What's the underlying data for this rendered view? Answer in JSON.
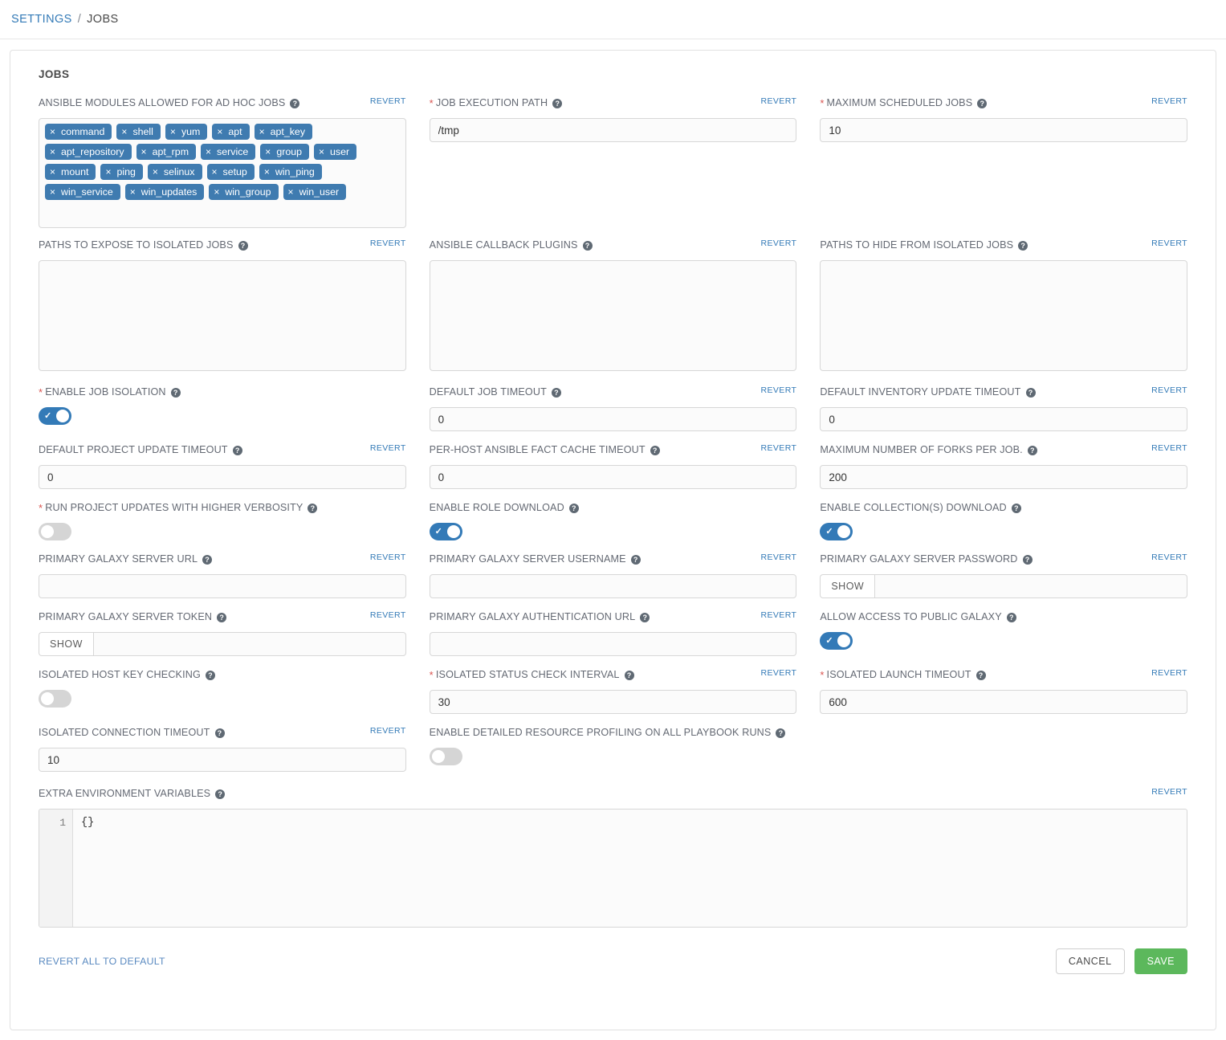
{
  "breadcrumb": {
    "root": "SETTINGS",
    "separator": "/",
    "current": "JOBS"
  },
  "panel": {
    "title": "JOBS",
    "revert_label": "REVERT",
    "show_label": "SHOW",
    "help_glyph": "?",
    "required_glyph": "*"
  },
  "colors": {
    "accent_blue": "#337ab7",
    "chip_blue": "#3f7bb0",
    "save_green": "#5cb85c",
    "required_red": "#d9534f",
    "label_gray": "#646973"
  },
  "fields": {
    "ansible_modules": {
      "label": "ANSIBLE MODULES ALLOWED FOR AD HOC JOBS",
      "required": false,
      "chips": [
        "command",
        "shell",
        "yum",
        "apt",
        "apt_key",
        "apt_repository",
        "apt_rpm",
        "service",
        "group",
        "user",
        "mount",
        "ping",
        "selinux",
        "setup",
        "win_ping",
        "win_service",
        "win_updates",
        "win_group",
        "win_user"
      ]
    },
    "job_execution_path": {
      "label": "JOB EXECUTION PATH",
      "required": true,
      "value": "/tmp"
    },
    "maximum_scheduled_jobs": {
      "label": "MAXIMUM SCHEDULED JOBS",
      "required": true,
      "value": "10"
    },
    "paths_expose_isolated": {
      "label": "PATHS TO EXPOSE TO ISOLATED JOBS",
      "required": false,
      "value": ""
    },
    "ansible_callback_plugins": {
      "label": "ANSIBLE CALLBACK PLUGINS",
      "required": false,
      "value": ""
    },
    "paths_hide_isolated": {
      "label": "PATHS TO HIDE FROM ISOLATED JOBS",
      "required": false,
      "value": ""
    },
    "enable_job_isolation": {
      "label": "ENABLE JOB ISOLATION",
      "required": true,
      "value": "on"
    },
    "default_job_timeout": {
      "label": "DEFAULT JOB TIMEOUT",
      "required": false,
      "value": "0"
    },
    "default_inventory_update_timeout": {
      "label": "DEFAULT INVENTORY UPDATE TIMEOUT",
      "required": false,
      "value": "0"
    },
    "default_project_update_timeout": {
      "label": "DEFAULT PROJECT UPDATE TIMEOUT",
      "required": false,
      "value": "0"
    },
    "per_host_fact_cache_timeout": {
      "label": "PER-HOST ANSIBLE FACT CACHE TIMEOUT",
      "required": false,
      "value": "0"
    },
    "maximum_forks_per_job": {
      "label": "MAXIMUM NUMBER OF FORKS PER JOB.",
      "required": false,
      "value": "200"
    },
    "project_updates_verbosity": {
      "label": "RUN PROJECT UPDATES WITH HIGHER VERBOSITY",
      "required": true,
      "value": "off"
    },
    "enable_role_download": {
      "label": "ENABLE ROLE DOWNLOAD",
      "required": false,
      "value": "on"
    },
    "enable_collections_download": {
      "label": "ENABLE COLLECTION(S) DOWNLOAD",
      "required": false,
      "value": "on"
    },
    "galaxy_server_url": {
      "label": "PRIMARY GALAXY SERVER URL",
      "required": false,
      "value": ""
    },
    "galaxy_server_username": {
      "label": "PRIMARY GALAXY SERVER USERNAME",
      "required": false,
      "value": ""
    },
    "galaxy_server_password": {
      "label": "PRIMARY GALAXY SERVER PASSWORD",
      "required": false,
      "value": ""
    },
    "galaxy_server_token": {
      "label": "PRIMARY GALAXY SERVER TOKEN",
      "required": false,
      "value": ""
    },
    "galaxy_auth_url": {
      "label": "PRIMARY GALAXY AUTHENTICATION URL",
      "required": false,
      "value": ""
    },
    "allow_public_galaxy": {
      "label": "ALLOW ACCESS TO PUBLIC GALAXY",
      "required": false,
      "value": "on"
    },
    "isolated_host_key_checking": {
      "label": "ISOLATED HOST KEY CHECKING",
      "required": false,
      "value": "off"
    },
    "isolated_status_check_interval": {
      "label": "ISOLATED STATUS CHECK INTERVAL",
      "required": true,
      "value": "30"
    },
    "isolated_launch_timeout": {
      "label": "ISOLATED LAUNCH TIMEOUT",
      "required": true,
      "value": "600"
    },
    "isolated_connection_timeout": {
      "label": "ISOLATED CONNECTION TIMEOUT",
      "required": false,
      "value": "10"
    },
    "detailed_resource_profiling": {
      "label": "ENABLE DETAILED RESOURCE PROFILING ON ALL PLAYBOOK RUNS",
      "required": false,
      "value": "off"
    },
    "extra_environment_variables": {
      "label": "EXTRA ENVIRONMENT VARIABLES",
      "required": false,
      "line_number": "1",
      "value": "{}"
    }
  },
  "footer": {
    "revert_all": "REVERT ALL TO DEFAULT",
    "cancel": "CANCEL",
    "save": "SAVE"
  }
}
